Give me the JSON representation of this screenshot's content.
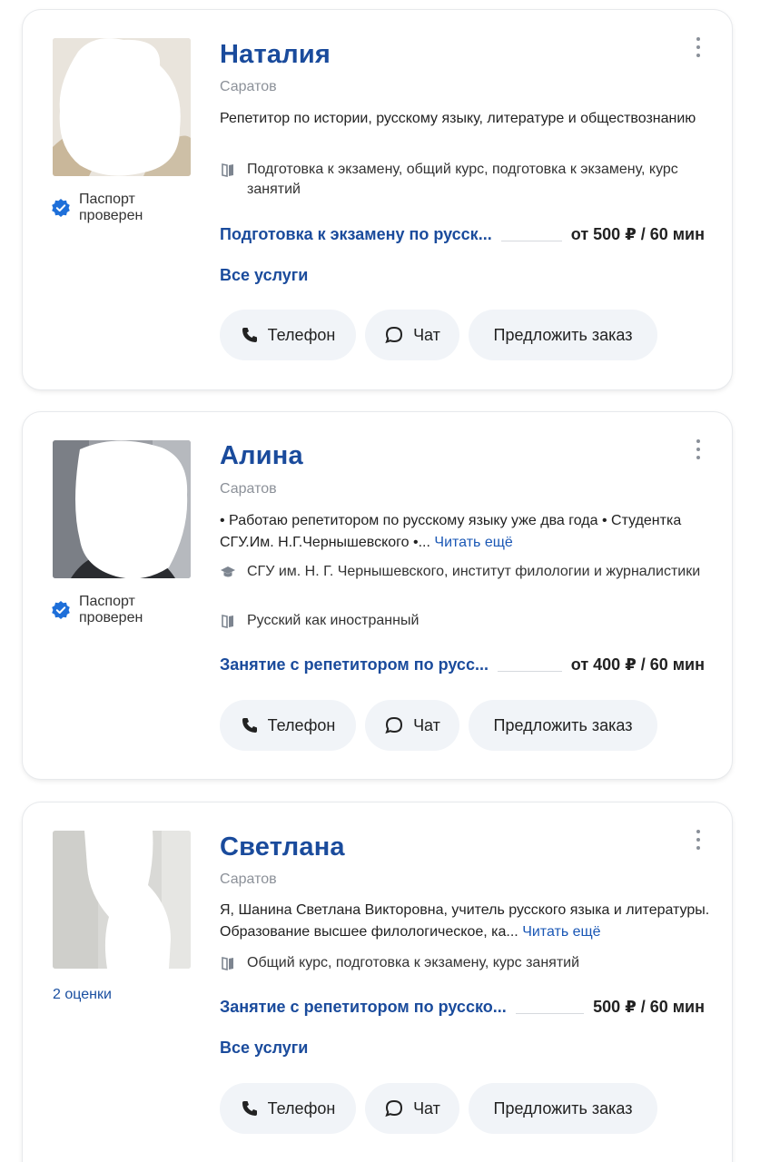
{
  "cards": [
    {
      "name": "Наталия",
      "city": "Саратов",
      "description": "Репетитор по истории, русскому языку, литературе и обществознанию",
      "info": [
        {
          "icon": "book-icon",
          "text": "Подготовка к экзамену, общий курс, подготовка к экзамену, курс занятий"
        }
      ],
      "badge": "Паспорт проверен",
      "service": "Подготовка к экзамену по русск...",
      "price": "от 500 ₽ / 60 мин",
      "all_services": "Все услуги"
    },
    {
      "name": "Алина",
      "city": "Саратов",
      "description": "• Работаю репетитором по русскому языку уже два года • Студентка СГУ.Им. Н.Г.Чернышевского •...",
      "read_more": "Читать ещё",
      "info": [
        {
          "icon": "graduation-cap-icon",
          "text": "СГУ им. Н. Г. Чернышевского, институт филологии и журналистики"
        },
        {
          "icon": "book-icon",
          "text": "Русский как иностранный"
        }
      ],
      "badge": "Паспорт проверен",
      "service": "Занятие с репетитором по русс...",
      "price": "от 400 ₽ / 60 мин"
    },
    {
      "name": "Светлана",
      "city": "Саратов",
      "description": "Я, Шанина Светлана Викторовна, учитель русского языка и литературы. Образование высшее филологическое, ка...",
      "read_more": "Читать ещё",
      "info": [
        {
          "icon": "book-icon",
          "text": "Общий курс, подготовка к экзамену, курс занятий"
        }
      ],
      "ratings": "2 оценки",
      "service": "Занятие с репетитором по русско...",
      "price": "500 ₽ / 60 мин",
      "all_services": "Все услуги"
    }
  ],
  "buttons": {
    "phone": "Телефон",
    "chat": "Чат",
    "offer": "Предложить заказ"
  },
  "colors": {
    "accent": "#1a4b9c",
    "link": "#1a57b5",
    "button_bg": "#f1f4f8",
    "verified": "#1e6fd9"
  }
}
